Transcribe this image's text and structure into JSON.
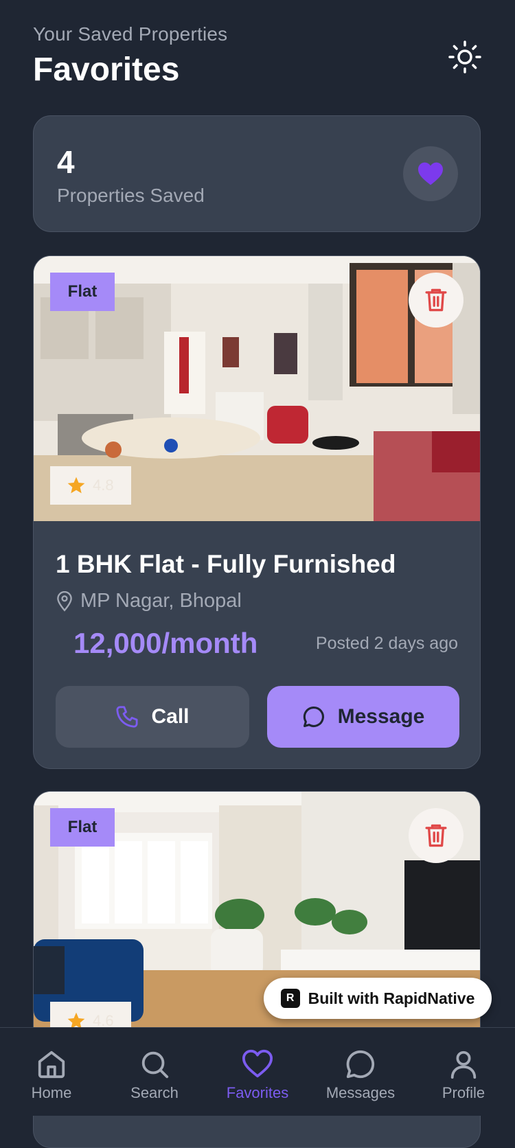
{
  "header": {
    "subtitle": "Your Saved Properties",
    "title": "Favorites",
    "theme_icon": "sun-icon"
  },
  "summary": {
    "count": "4",
    "label": "Properties Saved",
    "icon": "heart-icon"
  },
  "listings": [
    {
      "tag": "Flat",
      "rating": "4.8",
      "title": "1 BHK Flat - Fully Furnished",
      "location": "MP Nagar, Bhopal",
      "price": "12,000/month",
      "posted": "Posted 2 days ago",
      "call_label": "Call",
      "message_label": "Message"
    },
    {
      "tag": "Flat",
      "rating": "4.6"
    }
  ],
  "badge": {
    "label": "Built with RapidNative"
  },
  "tabs": [
    {
      "label": "Home",
      "icon": "home-icon"
    },
    {
      "label": "Search",
      "icon": "search-icon"
    },
    {
      "label": "Favorites",
      "icon": "heart-icon",
      "active": true
    },
    {
      "label": "Messages",
      "icon": "message-icon"
    },
    {
      "label": "Profile",
      "icon": "user-icon"
    }
  ],
  "colors": {
    "background": "#1f2633",
    "card": "#384150",
    "accent": "#a58af8",
    "delete": "#e04848",
    "star": "#f5a623"
  }
}
